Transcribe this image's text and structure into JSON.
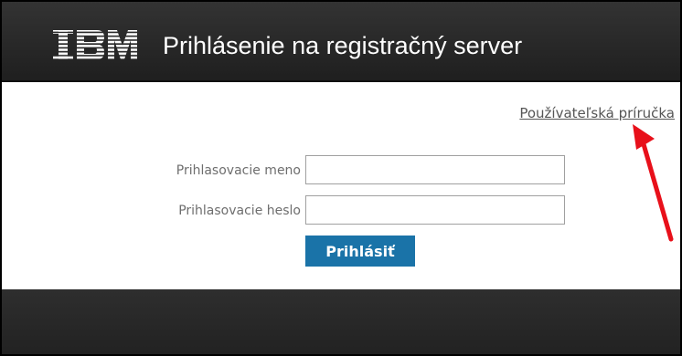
{
  "header": {
    "logo_text": "IBM",
    "title": "Prihlásenie na registračný server"
  },
  "links": {
    "user_manual": "Používateľská príručka"
  },
  "form": {
    "username_label": "Prihlasovacie meno",
    "username_value": "",
    "password_label": "Prihlasovacie heslo",
    "password_value": "",
    "submit_label": "Prihlásiť"
  },
  "colors": {
    "header_bg": "#2a2a2a",
    "button_bg": "#1a73a8",
    "arrow": "#e8101a"
  },
  "icons": {
    "annotation": "red-arrow-icon"
  }
}
